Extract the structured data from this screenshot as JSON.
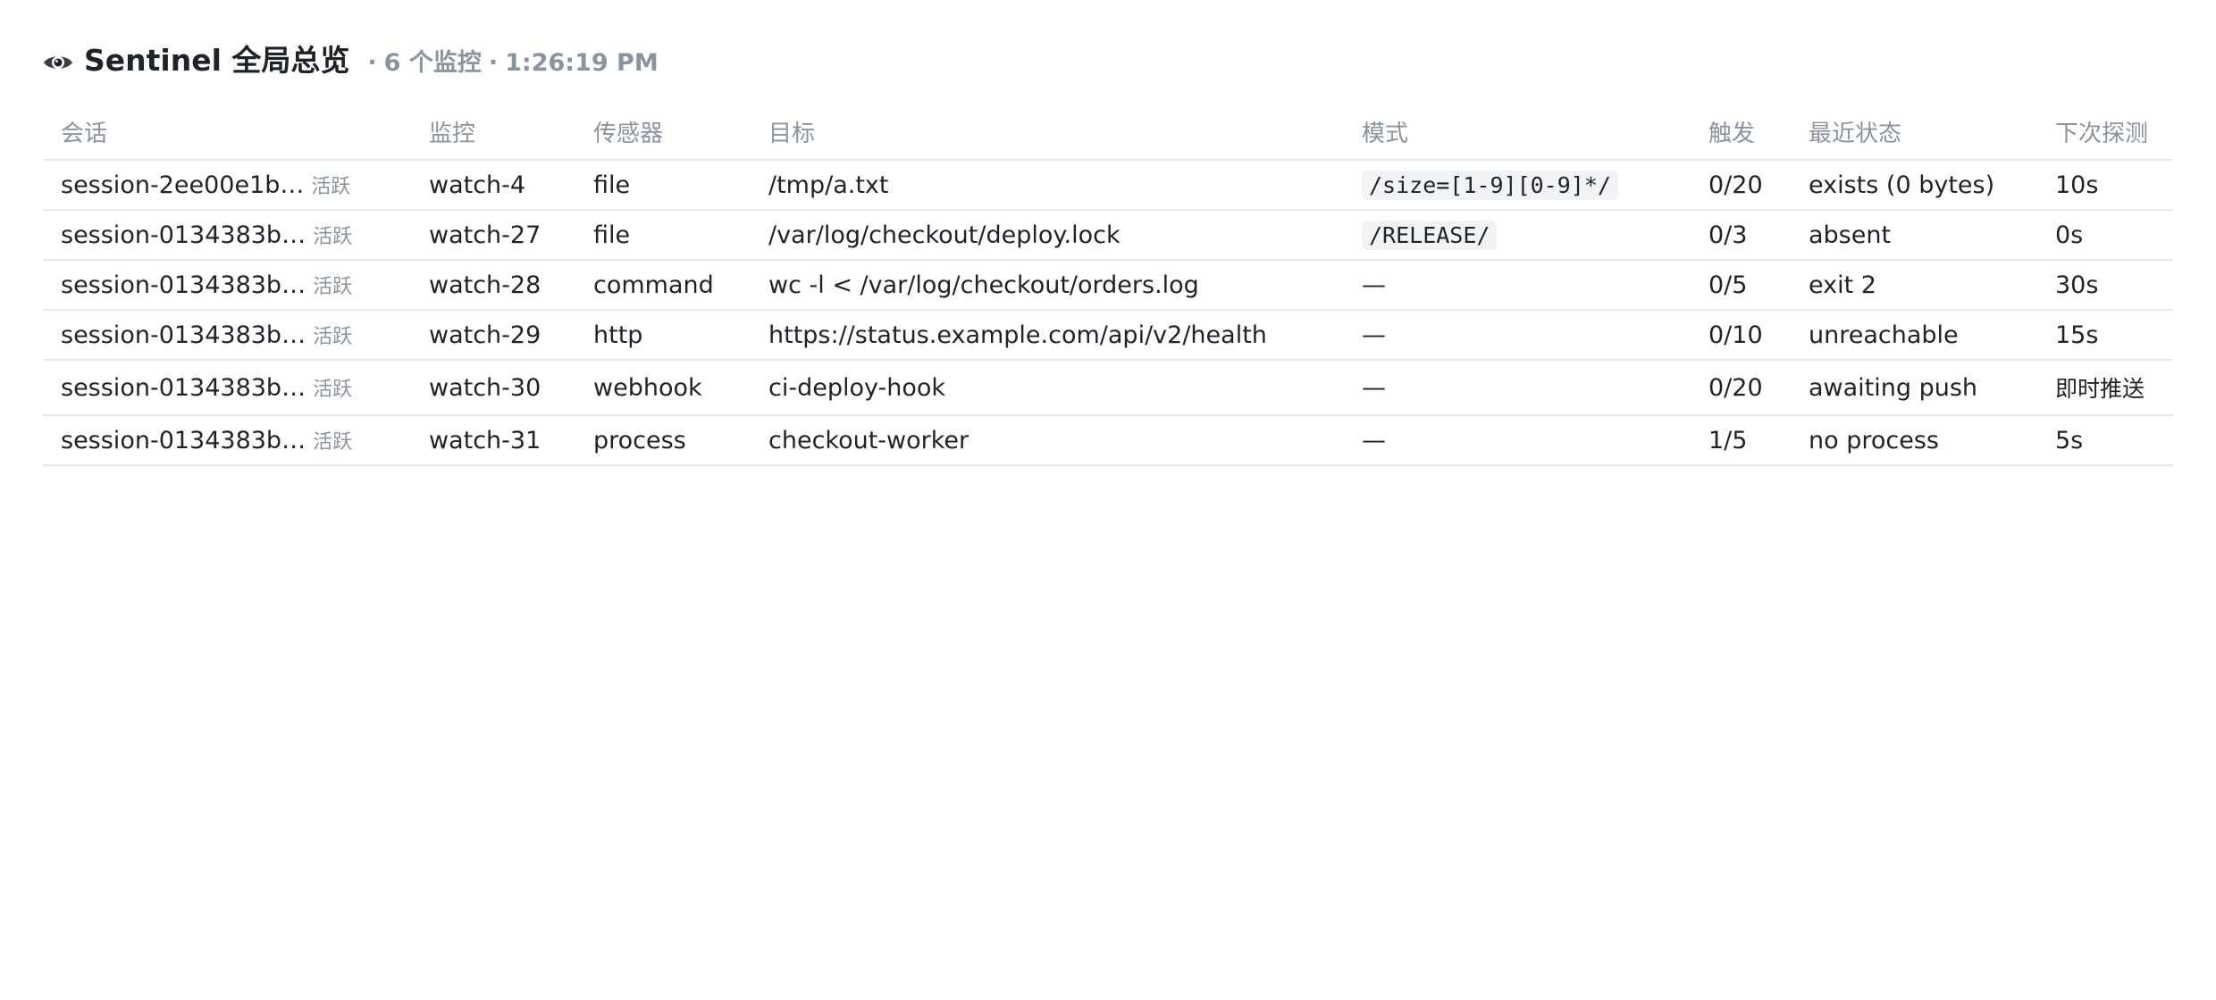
{
  "header": {
    "icon": "eye-icon",
    "title": "Sentinel 全局总览",
    "watch_count": "6 个监控",
    "time": "1:26:19 PM",
    "separator": "·"
  },
  "table": {
    "columns": [
      "会话",
      "监控",
      "传感器",
      "目标",
      "模式",
      "触发",
      "最近状态",
      "下次探测"
    ],
    "rows": [
      {
        "session": "session-2ee00e1b…",
        "tag": "活跃",
        "watch": "watch-4",
        "sensor": "file",
        "target": "/tmp/a.txt",
        "pattern": "/size=[1-9][0-9]*/",
        "trigger": "0/20",
        "status": "exists (0 bytes)",
        "next": "10s"
      },
      {
        "session": "session-0134383b…",
        "tag": "活跃",
        "watch": "watch-27",
        "sensor": "file",
        "target": "/var/log/checkout/deploy.lock",
        "pattern": "/RELEASE/",
        "trigger": "0/3",
        "status": "absent",
        "next": "0s"
      },
      {
        "session": "session-0134383b…",
        "tag": "活跃",
        "watch": "watch-28",
        "sensor": "command",
        "target": "wc -l < /var/log/checkout/orders.log",
        "pattern": "—",
        "trigger": "0/5",
        "status": "exit 2",
        "next": "30s"
      },
      {
        "session": "session-0134383b…",
        "tag": "活跃",
        "watch": "watch-29",
        "sensor": "http",
        "target": "https://status.example.com/api/v2/health",
        "pattern": "—",
        "trigger": "0/10",
        "status": "unreachable",
        "next": "15s"
      },
      {
        "session": "session-0134383b…",
        "tag": "活跃",
        "watch": "watch-30",
        "sensor": "webhook",
        "target": "ci-deploy-hook",
        "pattern": "—",
        "trigger": "0/20",
        "status": "awaiting push",
        "next": "即时推送"
      },
      {
        "session": "session-0134383b…",
        "tag": "活跃",
        "watch": "watch-31",
        "sensor": "process",
        "target": "checkout-worker",
        "pattern": "—",
        "trigger": "1/5",
        "status": "no process",
        "next": "5s"
      }
    ]
  }
}
